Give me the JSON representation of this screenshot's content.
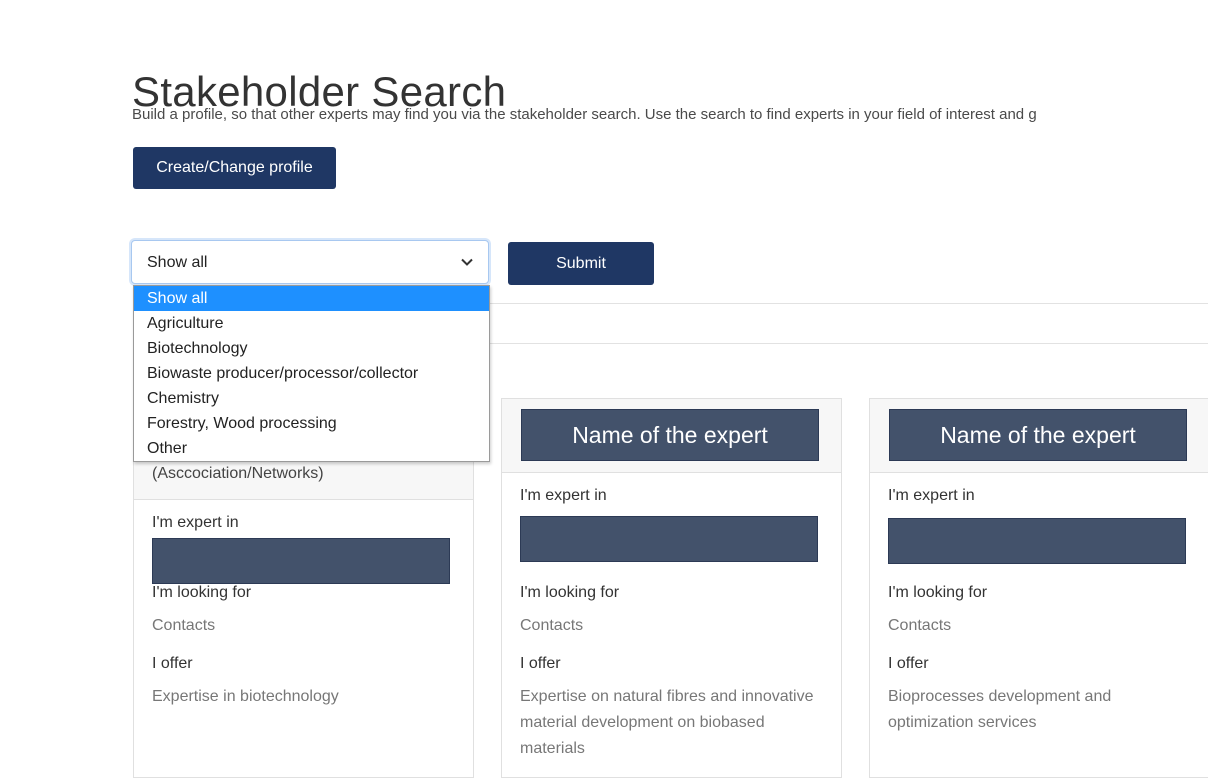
{
  "page": {
    "title": "Stakeholder Search",
    "intro": "Build a profile, so that other experts may find you via the stakeholder search. Use the search to find experts in your field of interest and g"
  },
  "profile_button": {
    "label": "Create/Change profile"
  },
  "filter": {
    "selected": "Show all",
    "options": [
      "Show all",
      "Agriculture",
      "Biotechnology",
      "Biowaste producer/processor/collector",
      "Chemistry",
      "Forestry, Wood processing",
      "Other"
    ],
    "submit_label": "Submit"
  },
  "cards": [
    {
      "header_tail": "(Asccociation/Networks)",
      "expert_label": "I'm expert in",
      "looking_label": "I'm looking for",
      "looking_value": "Contacts",
      "offer_label": "I offer",
      "offer_value": "Expertise in biotechnology"
    },
    {
      "name": "Name of the expert",
      "expert_label": "I'm expert in",
      "looking_label": "I'm looking for",
      "looking_value": "Contacts",
      "offer_label": "I offer",
      "offer_value": "Expertise on natural fibres and innovative material development on biobased materials"
    },
    {
      "name": "Name of the expert",
      "expert_label": "I'm expert in",
      "looking_label": "I'm looking for",
      "looking_value": "Contacts",
      "offer_label": "I offer",
      "offer_value": "Bioprocesses development and optimization services"
    }
  ],
  "colors": {
    "primary": "#1f3764",
    "banner": "#43526b",
    "selected_option": "#1e90ff"
  }
}
